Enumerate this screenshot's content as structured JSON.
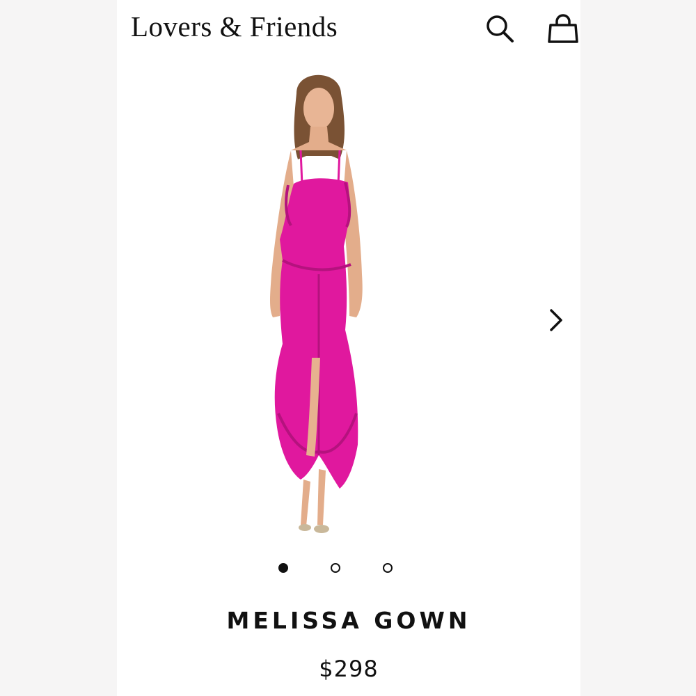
{
  "header": {
    "brand": "Lovers & Friends",
    "search_icon": "search-icon",
    "bag_icon": "shopping-bag-icon"
  },
  "gallery": {
    "next_icon": "chevron-right-icon",
    "dot_count": 3,
    "active_dot": 1
  },
  "product": {
    "name": "MELISSA GOWN",
    "price": "$298",
    "dress_color": "#e0189e"
  }
}
